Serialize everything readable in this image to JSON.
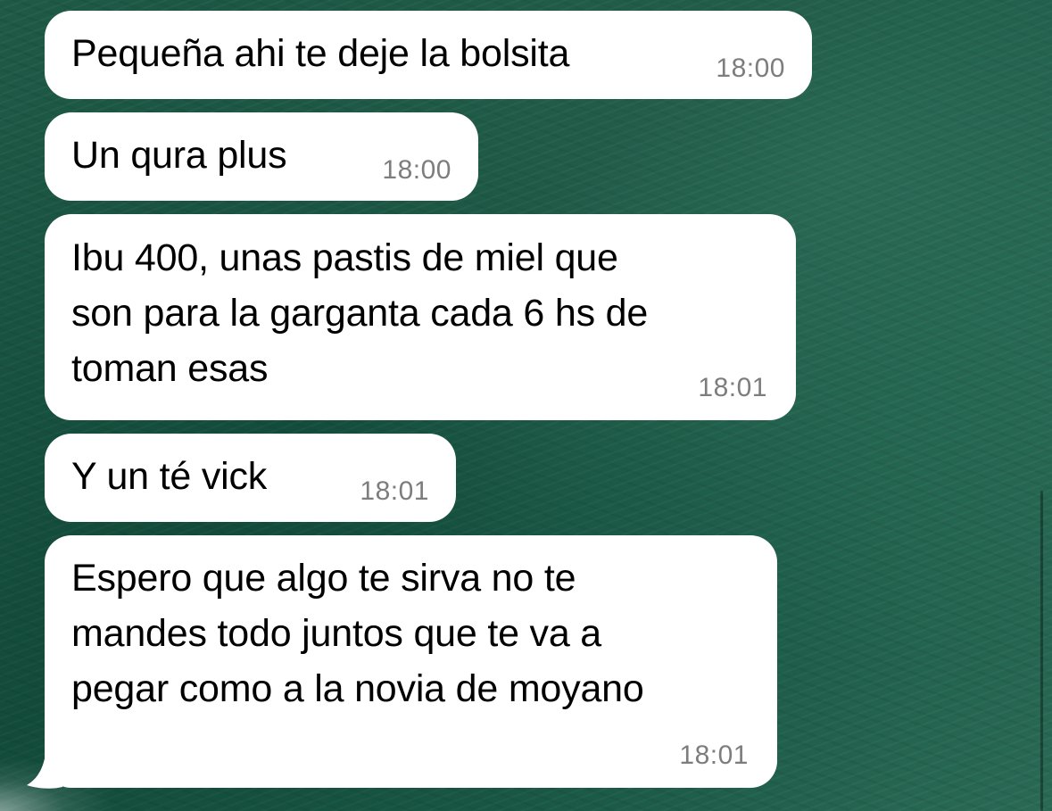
{
  "chat": {
    "messages": [
      {
        "text": "Pequeña ahi te deje la bolsita",
        "time": "18:00"
      },
      {
        "text": "Un qura plus",
        "time": "18:00"
      },
      {
        "text": "Ibu 400, unas pastis de miel que\nson para la garganta cada 6 hs de\ntoman esas",
        "time": "18:01"
      },
      {
        "text": "Y un té vick",
        "time": "18:01"
      },
      {
        "text": "Espero que algo te sirva no te\nmandes todo juntos que te va a\npegar como a la novia de moyano",
        "time": "18:01"
      }
    ]
  },
  "colors": {
    "bubble": "#ffffff",
    "timestamp": "#7d7d7d",
    "wallpaper": "#1a5643"
  }
}
